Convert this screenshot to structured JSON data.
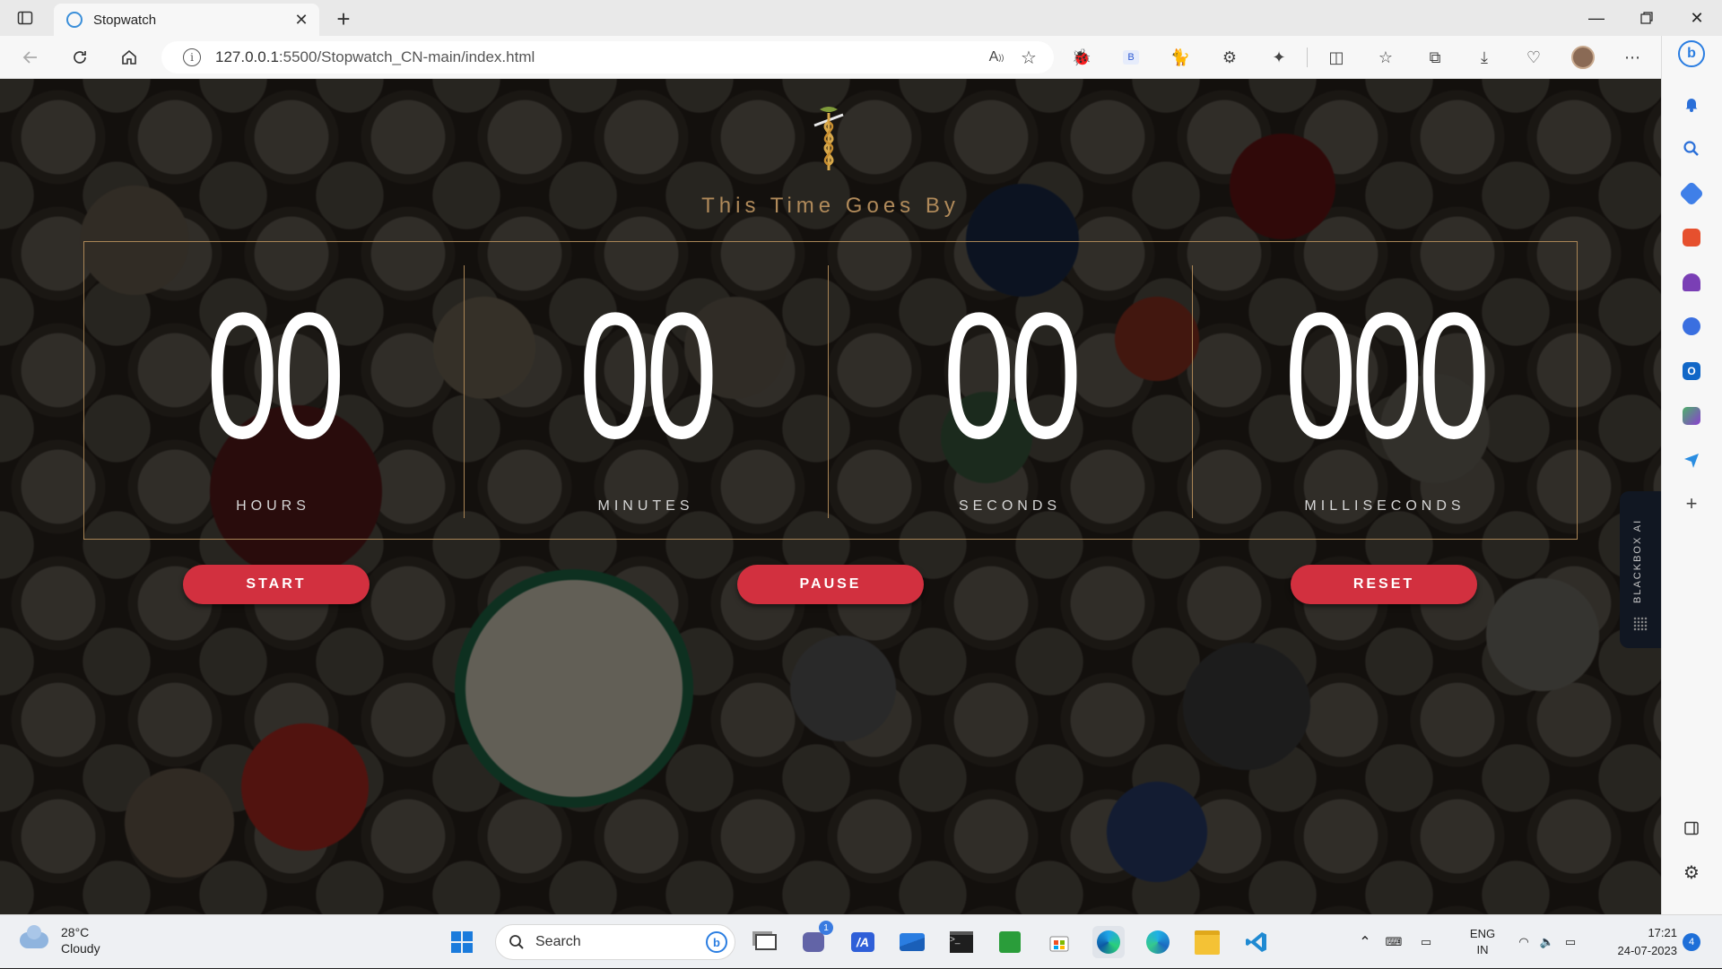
{
  "browser": {
    "tab_title": "Stopwatch",
    "url_host": "127.0.0.1",
    "url_rest": ":5500/Stopwatch_CN-main/index.html",
    "reading_icon": "read-aloud-icon",
    "favorite_icon": "star-icon"
  },
  "page": {
    "title": "This Time Goes By",
    "units": [
      {
        "value": "00",
        "label": "HOURS"
      },
      {
        "value": "00",
        "label": "MINUTES"
      },
      {
        "value": "00",
        "label": "SECONDS"
      },
      {
        "value": "000",
        "label": "MILLISECONDS"
      }
    ],
    "buttons": {
      "start": "START",
      "pause": "PAUSE",
      "reset": "RESET"
    },
    "accent_color": "#d2303f",
    "frame_color": "#a98556"
  },
  "blackbox": {
    "label": "BLACKBOX AI"
  },
  "taskbar": {
    "weather_temp": "28°C",
    "weather_desc": "Cloudy",
    "search_label": "Search",
    "lang_line1": "ENG",
    "lang_line2": "IN",
    "time": "17:21",
    "date": "24-07-2023",
    "notification_count": "4",
    "teams_badge": "1"
  }
}
